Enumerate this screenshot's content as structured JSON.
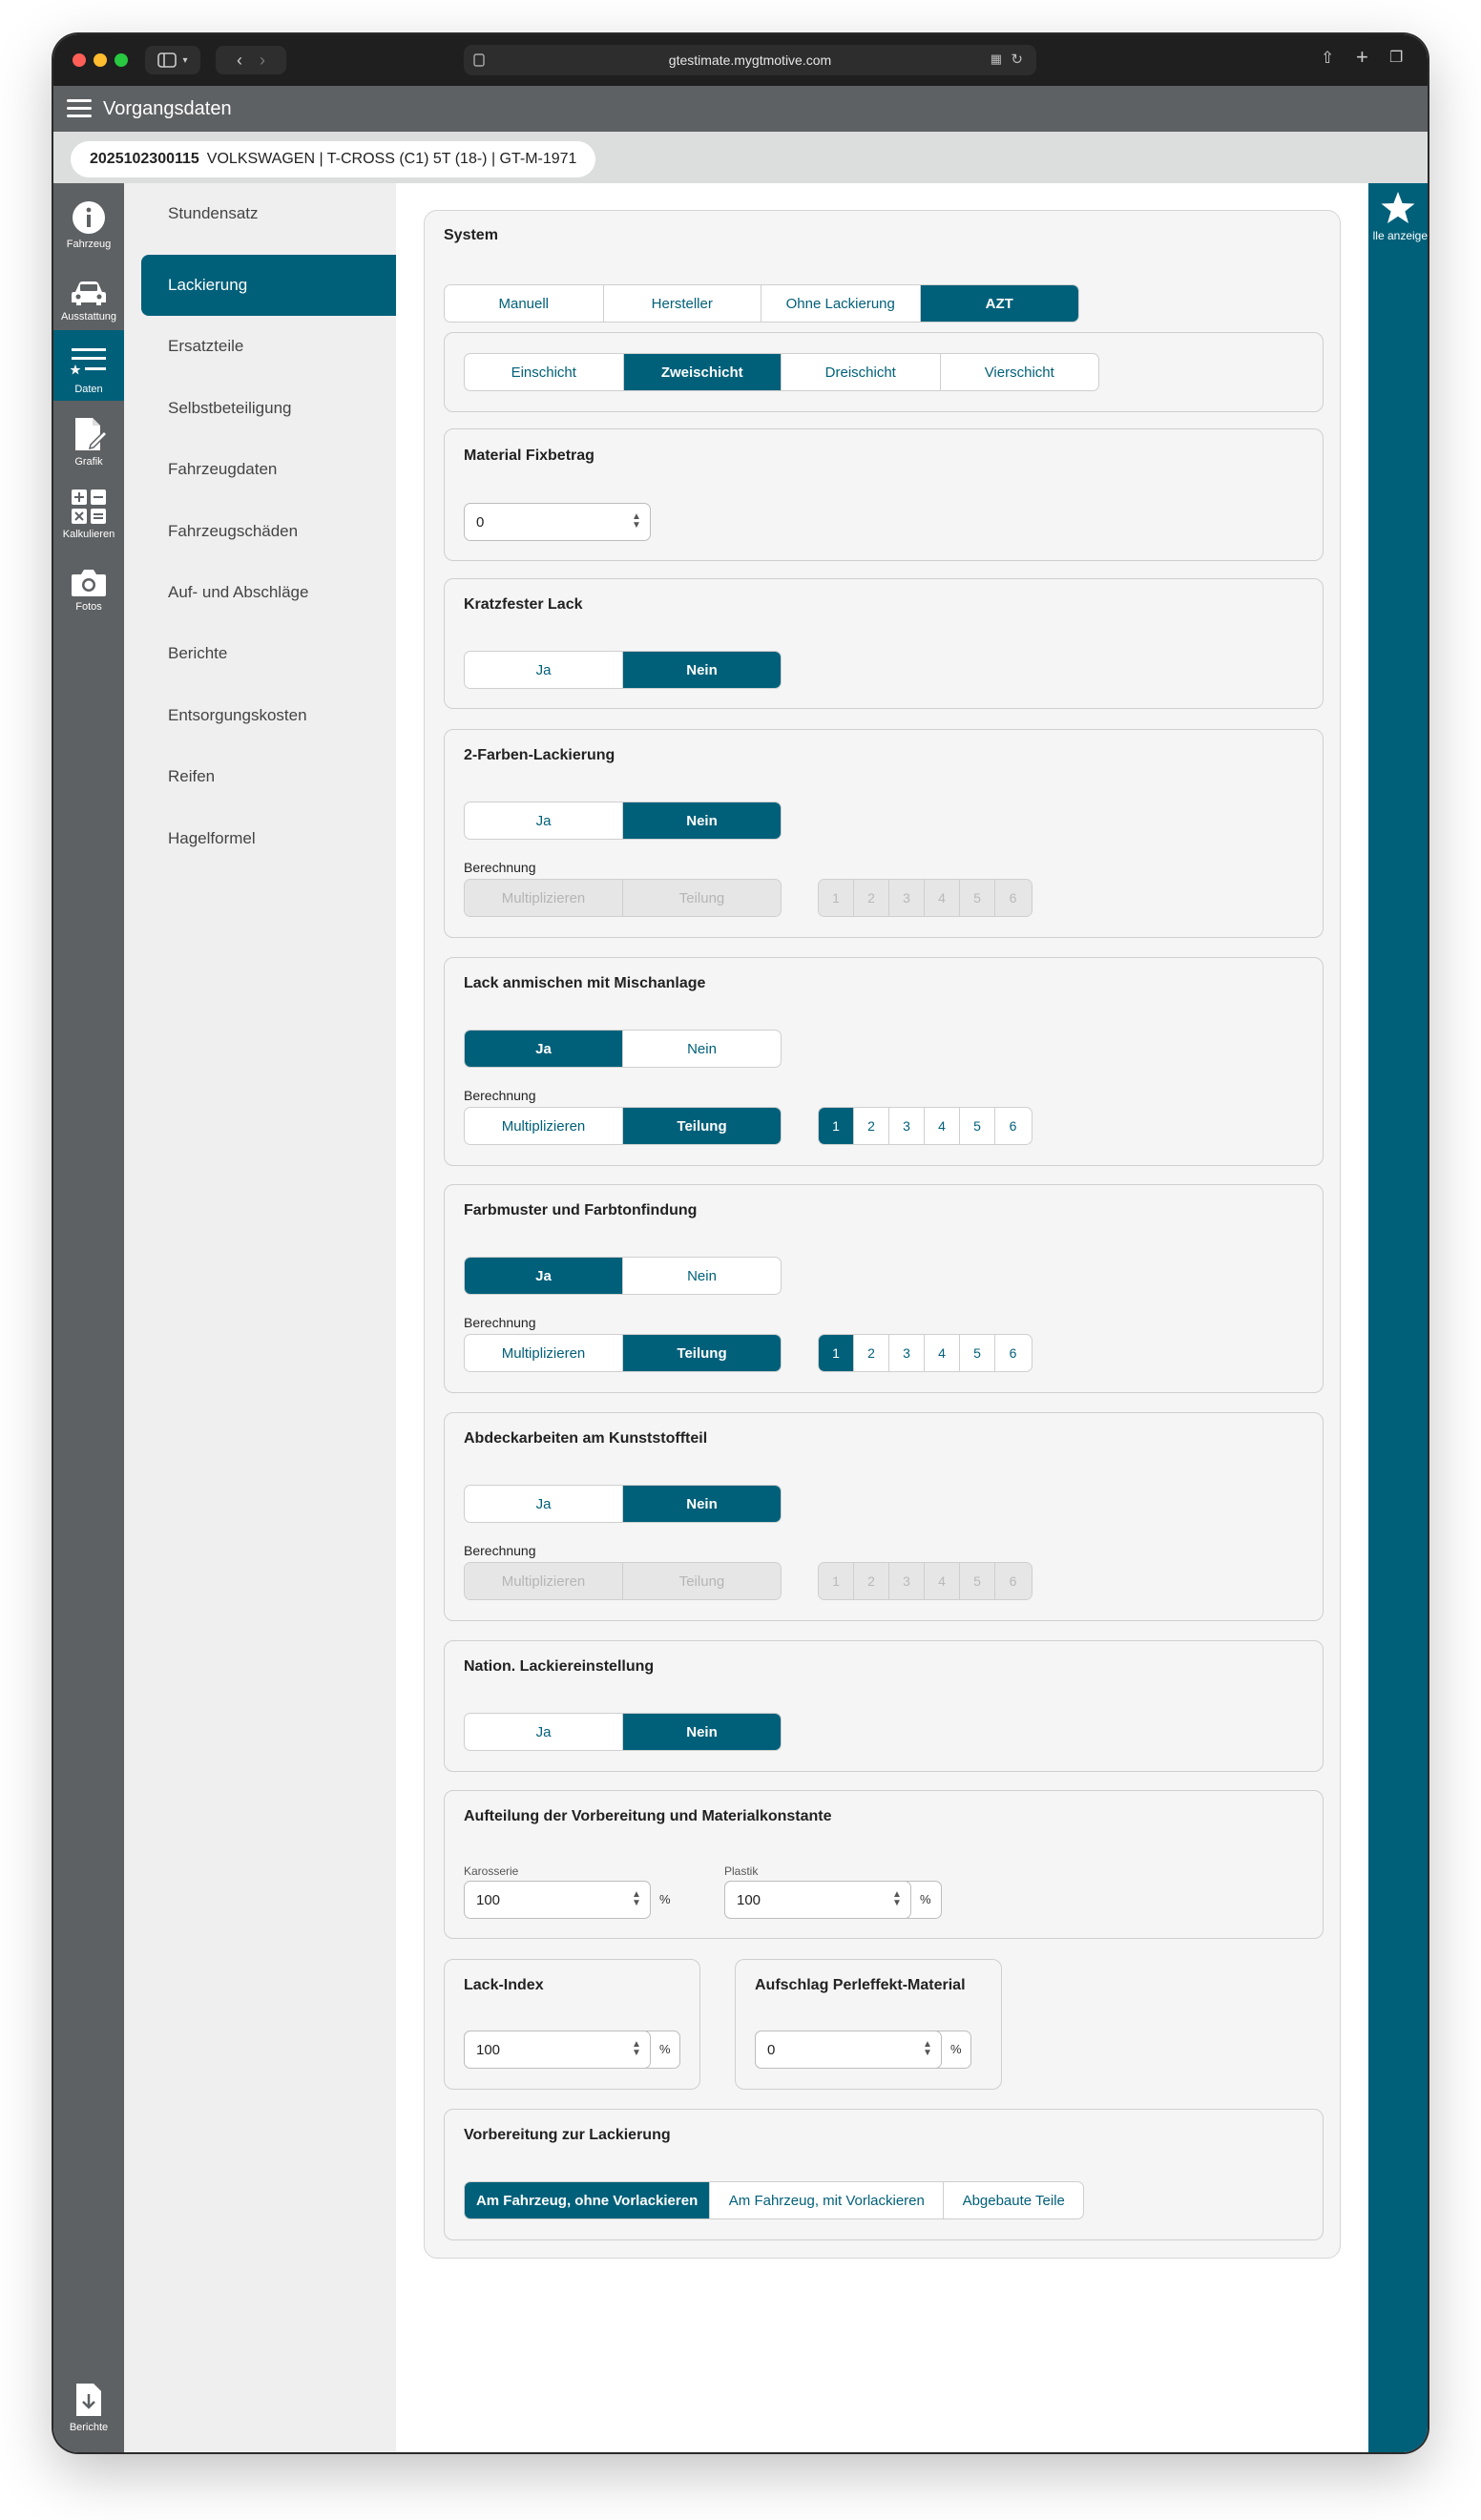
{
  "browser": {
    "url": "gtestimate.mygtmotive.com"
  },
  "app": {
    "title": "Vorgangsdaten",
    "crumb_id": "2025102300115",
    "crumb_vehicle": "VOLKSWAGEN | T-CROSS (C1) 5T (18-) | GT-M-1971"
  },
  "left_rail": {
    "items": [
      "Fahrzeug",
      "Ausstattung",
      "Daten",
      "Grafik",
      "Kalkulieren",
      "Fotos"
    ],
    "bottom": "Berichte"
  },
  "right_rail": {
    "label": "lle anzeige"
  },
  "subnav": {
    "items": [
      "Stundensatz",
      "Lackierung",
      "Ersatzteile",
      "Selbstbeteiligung",
      "Fahrzeugdaten",
      "Fahrzeugschäden",
      "Auf- und Abschläge",
      "Berichte",
      "Entsorgungskosten",
      "Reifen",
      "Hagelformel"
    ]
  },
  "system": {
    "title": "System",
    "options": [
      "Manuell",
      "Hersteller",
      "Ohne Lackierung",
      "AZT"
    ],
    "layers": [
      "Einschicht",
      "Zweischicht",
      "Dreischicht",
      "Vierschicht"
    ]
  },
  "material": {
    "title": "Material Fixbetrag",
    "value": "0"
  },
  "kratz": {
    "title": "Kratzfester Lack"
  },
  "yesno": [
    "Ja",
    "Nein"
  ],
  "berechnung_label": "Berechnung",
  "calc": [
    "Multiplizieren",
    "Teilung"
  ],
  "numbers": [
    "1",
    "2",
    "3",
    "4",
    "5",
    "6"
  ],
  "farben2": {
    "title": "2-Farben-Lackierung"
  },
  "mischanlage": {
    "title": "Lack anmischen mit Mischanlage"
  },
  "farbmuster": {
    "title": "Farbmuster und Farbtonfindung"
  },
  "abdeck": {
    "title": "Abdeckarbeiten am Kunststoffteil"
  },
  "nation": {
    "title": "Nation. Lackiereinstellung"
  },
  "aufteilung": {
    "title": "Aufteilung der Vorbereitung und Materialkonstante",
    "karosserie_label": "Karosserie",
    "karosserie_value": "100",
    "plastik_label": "Plastik",
    "plastik_value": "100",
    "unit": "%"
  },
  "lackindex": {
    "title": "Lack-Index",
    "value": "100",
    "unit": "%"
  },
  "perleffekt": {
    "title": "Aufschlag Perleffekt-Material",
    "value": "0",
    "unit": "%"
  },
  "vorbereitung": {
    "title": "Vorbereitung zur Lackierung",
    "options": [
      "Am Fahrzeug, ohne Vorlackieren",
      "Am Fahrzeug, mit Vorlackieren",
      "Abgebaute Teile"
    ]
  },
  "colors": {
    "accent": "#00607a",
    "rail": "#5e6163"
  }
}
